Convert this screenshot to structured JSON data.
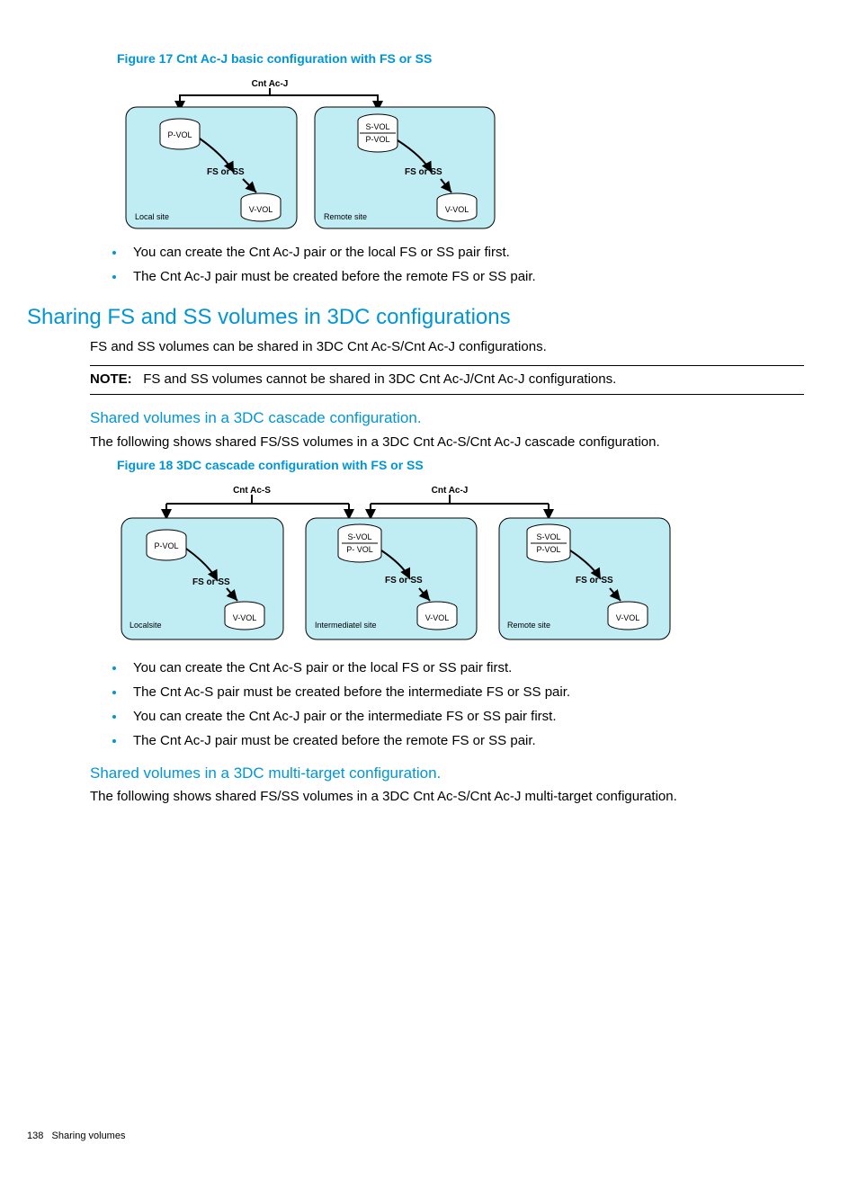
{
  "fig17": {
    "caption": "Figure 17 Cnt Ac-J basic configuration with FS or SS",
    "topLabel": "Cnt Ac-J",
    "local": {
      "site": "Local site",
      "pvol": "P-VOL",
      "mid": "FS or SS",
      "vvol": "V-VOL"
    },
    "remote": {
      "site": "Remote site",
      "svol": "S-VOL",
      "pvol": "P-VOL",
      "mid": "FS or SS",
      "vvol": "V-VOL"
    }
  },
  "bullets17": [
    "You can create the Cnt Ac-J pair or the local FS or SS pair first.",
    "The Cnt Ac-J pair must be created before the remote FS or SS pair."
  ],
  "h2": "Sharing FS and SS volumes in 3DC configurations",
  "p1": "FS and SS volumes can be shared in 3DC Cnt Ac-S/Cnt Ac-J configurations.",
  "noteLabel": "NOTE:",
  "noteText": "FS and SS volumes cannot be shared in 3DC Cnt Ac-J/Cnt Ac-J configurations.",
  "h3a": "Shared volumes in a 3DC cascade configuration.",
  "p2": "The following shows shared FS/SS volumes in a 3DC Cnt Ac-S/Cnt Ac-J cascade configuration.",
  "fig18": {
    "caption": "Figure 18 3DC cascade configuration with FS or SS",
    "topLeft": "Cnt Ac-S",
    "topRight": "Cnt Ac-J",
    "local": {
      "site": "Localsite",
      "pvol": "P-VOL",
      "mid": "FS or SS",
      "vvol": "V-VOL"
    },
    "inter": {
      "site": "Intermediatel site",
      "svol": "S-VOL",
      "pvol": "P- VOL",
      "mid": "FS or SS",
      "vvol": "V-VOL"
    },
    "remote": {
      "site": "Remote site",
      "svol": "S-VOL",
      "pvol": "P-VOL",
      "mid": "FS or SS",
      "vvol": "V-VOL"
    }
  },
  "bullets18": [
    "You can create the Cnt Ac-S pair or the local FS or SS pair first.",
    "The Cnt Ac-S pair must be created before the intermediate FS or SS pair.",
    "You can create the Cnt Ac-J pair or the intermediate FS or SS pair first.",
    "The Cnt Ac-J pair must be created before the remote FS or SS pair."
  ],
  "h3b": "Shared volumes in a 3DC multi-target configuration.",
  "p3": "The following shows shared FS/SS volumes in a 3DC Cnt Ac-S/Cnt Ac-J multi-target configuration.",
  "footer": {
    "page": "138",
    "section": "Sharing volumes"
  }
}
